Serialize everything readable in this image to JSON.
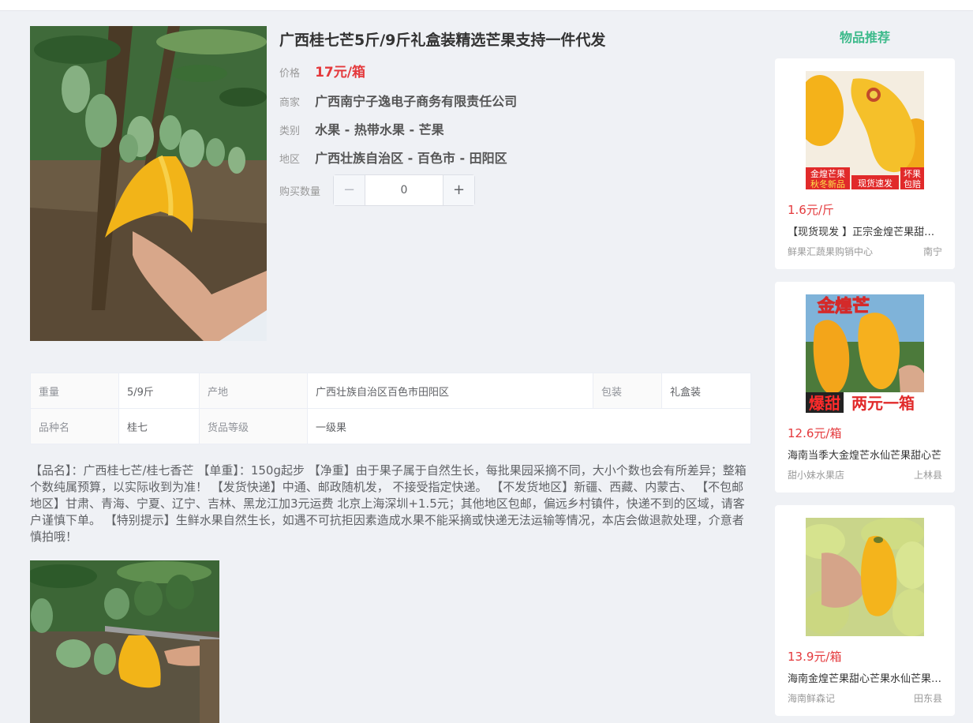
{
  "product": {
    "title": "广西桂七芒5斤/9斤礼盒装精选芒果支持一件代发",
    "price_label": "价格",
    "price": "17元/箱",
    "seller_label": "商家",
    "seller": "广西南宁子逸电子商务有限责任公司",
    "category_label": "类别",
    "category": "水果 - 热带水果 - 芒果",
    "region_label": "地区",
    "region": "广西壮族自治区 - 百色市 - 田阳区",
    "qty_label": "购买数量",
    "qty_value": "0",
    "qty_minus": "−",
    "qty_plus": "+"
  },
  "specs": {
    "weight_k": "重量",
    "weight_v": "5/9斤",
    "origin_k": "产地",
    "origin_v": "广西壮族自治区百色市田阳区",
    "pack_k": "包装",
    "pack_v": "礼盒装",
    "variety_k": "品种名",
    "variety_v": "桂七",
    "grade_k": "货品等级",
    "grade_v": "一级果"
  },
  "description": "【品名】：广西桂七芒/桂七香芒 【单重】：150g起步 【净重】由于果子属于自然生长，每批果园采摘不同，大小个数也会有所差异；整箱个数纯属预算，以实际收到为准！ 【发货快递】中通、邮政随机发， 不接受指定快递。 【不发货地区】新疆、西藏、内蒙古、 【不包邮地区】甘肃、青海、宁夏、辽宁、吉林、黑龙江加3元运费 北京上海深圳+1.5元；其他地区包邮，偏远乡村镇件，快递不到的区域，请客户谨慎下单。 【特别提示】生鲜水果自然生长，如遇不可抗拒因素造成水果不能采摘或快递无法运输等情况，本店会做退款处理，介意者慎拍哦！",
  "sidebar": {
    "title": "物品推荐",
    "items": [
      {
        "price": "1.6元/斤",
        "name": "【现货现发 】正宗金煌芒果甜心芒果",
        "shop": "鲜果汇蔬果购销中心",
        "location": "南宁",
        "badge1": "金煌芒果",
        "badge2": "秋冬新品",
        "badge3": "现货速发",
        "badge4": "坏果",
        "badge5": "包赔"
      },
      {
        "price": "12.6元/箱",
        "name": "海南当季大金煌芒水仙芒果甜心芒",
        "shop": "甜小妹水果店",
        "location": "上林县",
        "banner": "金煌芒",
        "slogan1": "爆甜",
        "slogan2": "两元一箱"
      },
      {
        "price": "13.9元/箱",
        "name": "海南金煌芒果甜心芒果水仙芒果新鲜",
        "shop": "海南鲜森记",
        "location": "田东县"
      }
    ]
  },
  "colors": {
    "price_red": "#e4393c",
    "accent_green": "#3dba8b",
    "mango_yellow": "#f2b418"
  }
}
